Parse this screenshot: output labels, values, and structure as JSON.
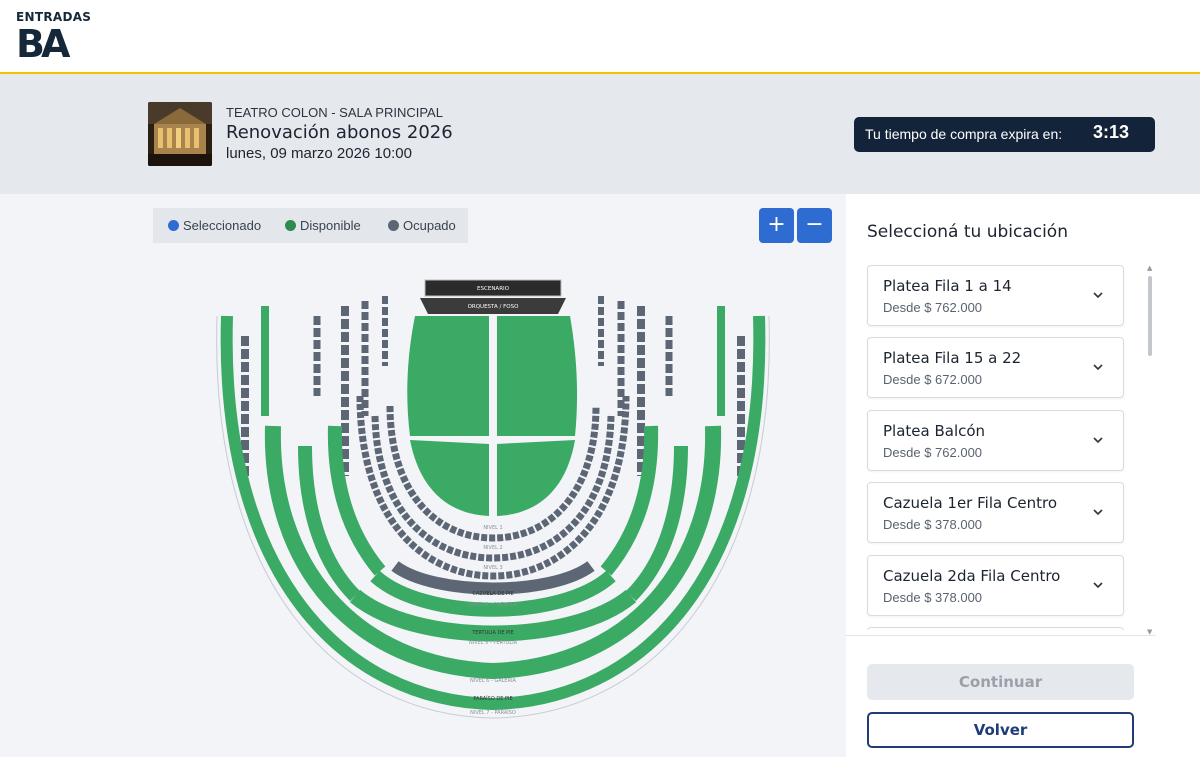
{
  "brand": {
    "logo_top": "ENTRADAS",
    "logo_mark": "BA"
  },
  "event": {
    "venue": "TEATRO COLON - SALA PRINCIPAL",
    "name": "Renovación abonos 2026",
    "date": "lunes, 09 marzo 2026 10:00"
  },
  "timer": {
    "label": "Tu tiempo de compra expira en:",
    "value": "3:13"
  },
  "legend": [
    {
      "label": "Seleccionado",
      "color": "#2f6cd1"
    },
    {
      "label": "Disponible",
      "color": "#2e8b4b"
    },
    {
      "label": "Ocupado",
      "color": "#5d6675"
    }
  ],
  "zoom": {
    "in_label": "+",
    "out_label": "−"
  },
  "seatmap": {
    "stage_label": "ESCENARIO",
    "pit_label": "ORQUESTA / FOSO",
    "available_color": "#3aaa64",
    "occupied_color": "#5d6675",
    "levels": [
      "NIVEL 1",
      "NIVEL 2",
      "NIVEL 3",
      "CAZUELA DE PIE",
      "NIVEL 4 - CAZUELA",
      "TERTULIA DE PIE",
      "NIVEL 5 - TERTULIA",
      "NIVEL 6 - GALERÍA",
      "PARAÍSO DE PIE",
      "NIVEL 7 - PARAÍSO"
    ]
  },
  "sidebar": {
    "title": "Seleccioná tu ubicación",
    "sections": [
      {
        "name": "Platea Fila 1 a 14",
        "price": "Desde $ 762.000"
      },
      {
        "name": "Platea Fila 15 a 22",
        "price": "Desde $ 672.000"
      },
      {
        "name": "Platea Balcón",
        "price": "Desde $ 762.000"
      },
      {
        "name": "Cazuela 1er Fila Centro",
        "price": "Desde $ 378.000"
      },
      {
        "name": "Cazuela 2da Fila Centro",
        "price": "Desde $ 378.000"
      }
    ],
    "continue_label": "Continuar",
    "back_label": "Volver"
  }
}
